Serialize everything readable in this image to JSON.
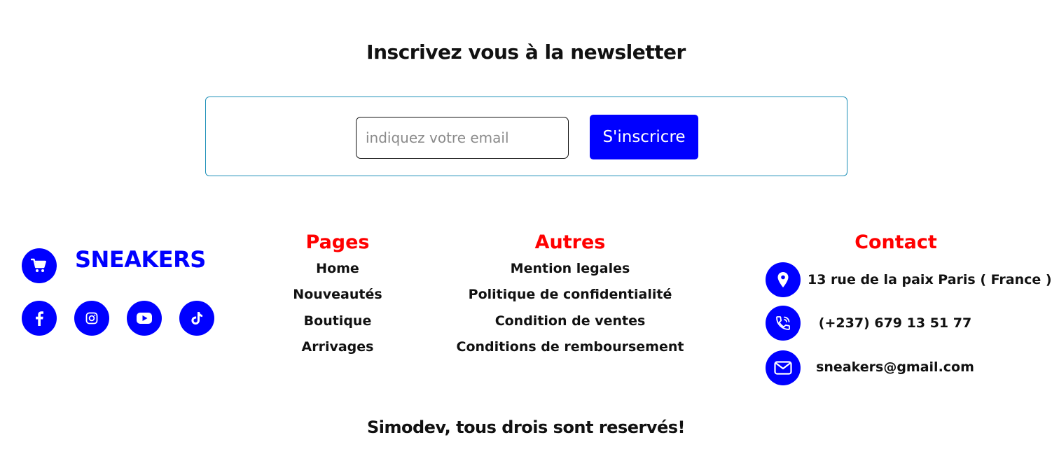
{
  "newsletter": {
    "title": "Inscrivez vous à la newsletter",
    "email_placeholder": "indiquez votre email",
    "button_label": "S'inscricre"
  },
  "brand": {
    "name": "SNEAKERS",
    "logo_icon": "cart-icon",
    "socials": [
      {
        "name": "facebook-icon"
      },
      {
        "name": "instagram-icon"
      },
      {
        "name": "youtube-icon"
      },
      {
        "name": "tiktok-icon"
      }
    ]
  },
  "pages": {
    "title": "Pages",
    "links": [
      "Home",
      "Nouveautés",
      "Boutique",
      "Arrivages"
    ]
  },
  "autres": {
    "title": "Autres",
    "links": [
      "Mention legales",
      "Politique de confidentialité",
      "Condition de ventes",
      "Conditions de remboursement"
    ]
  },
  "contact": {
    "title": "Contact",
    "address": "13 rue de la paix Paris ( France )",
    "phone": "(+237) 679 13 51 77",
    "email": "sneakers@gmail.com"
  },
  "footer": {
    "copyright": "Simodev, tous drois sont reservés!"
  },
  "colors": {
    "accent": "#0000ff",
    "heading_red": "#ff0000",
    "box_border": "#1e90b8"
  }
}
